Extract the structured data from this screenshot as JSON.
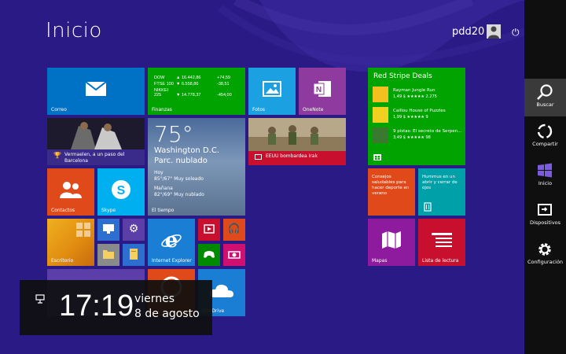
{
  "start": {
    "title": "Inicio",
    "user_name": "pdd20"
  },
  "tiles": {
    "correo": "Correo",
    "finanzas": {
      "label": "Finanzas",
      "rows": [
        {
          "name": "DOW",
          "value": "▲ 16.442,86",
          "change": "+74,59"
        },
        {
          "name": "FTSE 100",
          "value": "▼ 6.558,86",
          "change": "-38,51"
        },
        {
          "name": "NIKKEI 225",
          "value": "▼ 14.778,37",
          "change": "-454,00"
        }
      ]
    },
    "fotos": "Fotos",
    "onenote": "OneNote",
    "deportes": "Vermaelen, a un paso del Barcelona",
    "tiempo": {
      "temp": "75°",
      "city": "Washington D.C.",
      "condition": "Parc. nublado",
      "today_label": "Hoy",
      "today": "85°/67° Muy soleado",
      "tomorrow_label": "Mañana",
      "tomorrow": "82°/69° Muy nublado",
      "label": "El tiempo"
    },
    "noticias": "EEUU bombardea Irak",
    "contactos": "Contactos",
    "skype": "Skype",
    "escritorio": "Escritorio",
    "ie": "Internet Explorer",
    "onedrive": "OneDrive",
    "store": {
      "title": "Red Stripe Deals",
      "items": [
        {
          "name": "Rayman Jungle Run",
          "price": "1,49 $ ★★★★★ 2.275"
        },
        {
          "name": "Caillou House of Puzzles",
          "price": "1,99 $ ★★★★★ 9"
        },
        {
          "name": "9 pistas: El secreto de Serpen...",
          "price": "3,49 $ ★★★★★ 98"
        }
      ]
    },
    "salud": "Consejos saludables para hacer deporte en verano",
    "comida": "Hummus en un abrir y cerrar de ojos",
    "mapas": "Mapas",
    "lectura": "Lista de lectura"
  },
  "charms": {
    "buscar": "Buscar",
    "compartir": "Compartir",
    "inicio": "Inicio",
    "dispositivos": "Dispositivos",
    "configuracion": "Configuración"
  },
  "clock": {
    "time": "17:19",
    "day": "viernes",
    "date": "8 de agosto"
  },
  "colors": {
    "background": "#2a1a85",
    "charms_bar": "#0f0f0f",
    "store_green": "#00a300"
  }
}
